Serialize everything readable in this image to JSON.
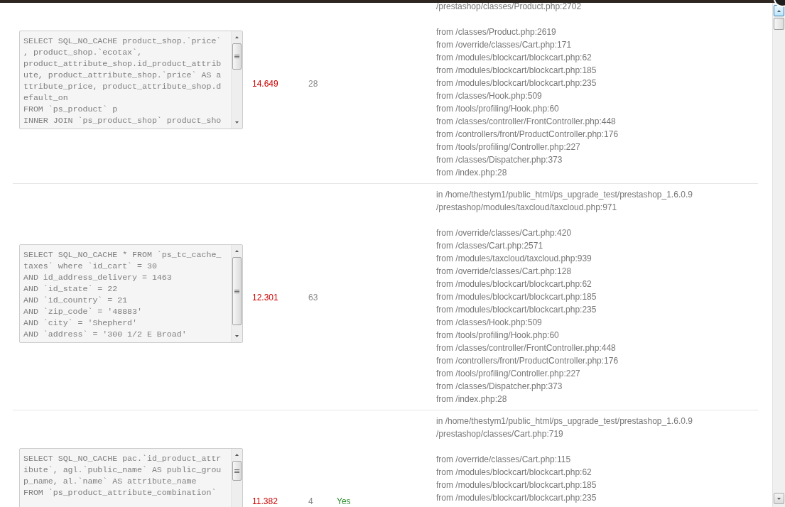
{
  "queries": [
    {
      "sql_lines": [
        "SELECT SQL_NO_CACHE product_shop.`price`",
        ", product_shop.`ecotax`,",
        "product_attribute_shop.id_product_attrib",
        "ute, product_attribute_shop.`price` AS a",
        "ttribute_price, product_attribute_shop.d",
        "efault_on",
        "FROM `ps_product` p",
        "INNER JOIN `ps_product_shop` product_sho"
      ],
      "time": "14.649",
      "count": "28",
      "location": [
        "/prestashop/classes/Product.php:2702"
      ],
      "callers": [
        "from /classes/Product.php:2619",
        "from /override/classes/Cart.php:171",
        "from /modules/blockcart/blockcart.php:62",
        "from /modules/blockcart/blockcart.php:185",
        "from /modules/blockcart/blockcart.php:235",
        "from /classes/Hook.php:509",
        "from /tools/profiling/Hook.php:60",
        "from /classes/controller/FrontController.php:448",
        "from /controllers/front/ProductController.php:176",
        "from /tools/profiling/Controller.php:227",
        "from /classes/Dispatcher.php:373",
        "from /index.php:28"
      ]
    },
    {
      "sql_lines": [
        "SELECT SQL_NO_CACHE * FROM `ps_tc_cache_",
        "taxes` where `id_cart` = 30",
        "AND id_address_delivery = 1463",
        "AND `id_state` = 22",
        "AND `id_country` = 21",
        "AND `zip_code` = '48883'",
        "AND `city` = 'Shepherd'",
        "AND `address` = '300 1/2 E Broad'"
      ],
      "time": "12.301",
      "count": "63",
      "location": [
        "in /home/thestym1/public_html/ps_upgrade_test/prestashop_1.6.0.9",
        "/prestashop/modules/taxcloud/taxcloud.php:971"
      ],
      "callers": [
        "from /override/classes/Cart.php:420",
        "from /classes/Cart.php:2571",
        "from /modules/taxcloud/taxcloud.php:939",
        "from /override/classes/Cart.php:128",
        "from /modules/blockcart/blockcart.php:62",
        "from /modules/blockcart/blockcart.php:185",
        "from /modules/blockcart/blockcart.php:235",
        "from /classes/Hook.php:509",
        "from /tools/profiling/Hook.php:60",
        "from /classes/controller/FrontController.php:448",
        "from /controllers/front/ProductController.php:176",
        "from /tools/profiling/Controller.php:227",
        "from /classes/Dispatcher.php:373",
        "from /index.php:28"
      ]
    },
    {
      "sql_lines": [
        "SELECT SQL_NO_CACHE pac.`id_product_attr",
        "ibute`, agl.`public_name` AS public_grou",
        "p_name, al.`name` AS attribute_name",
        "FROM `ps_product_attribute_combination`"
      ],
      "time": "11.382",
      "count": "4",
      "flag": "Yes",
      "location": [
        "in /home/thestym1/public_html/ps_upgrade_test/prestashop_1.6.0.9",
        "/prestashop/classes/Cart.php:719"
      ],
      "callers": [
        "from /override/classes/Cart.php:115",
        "from /modules/blockcart/blockcart.php:62",
        "from /modules/blockcart/blockcart.php:185",
        "from /modules/blockcart/blockcart.php:235"
      ]
    }
  ]
}
